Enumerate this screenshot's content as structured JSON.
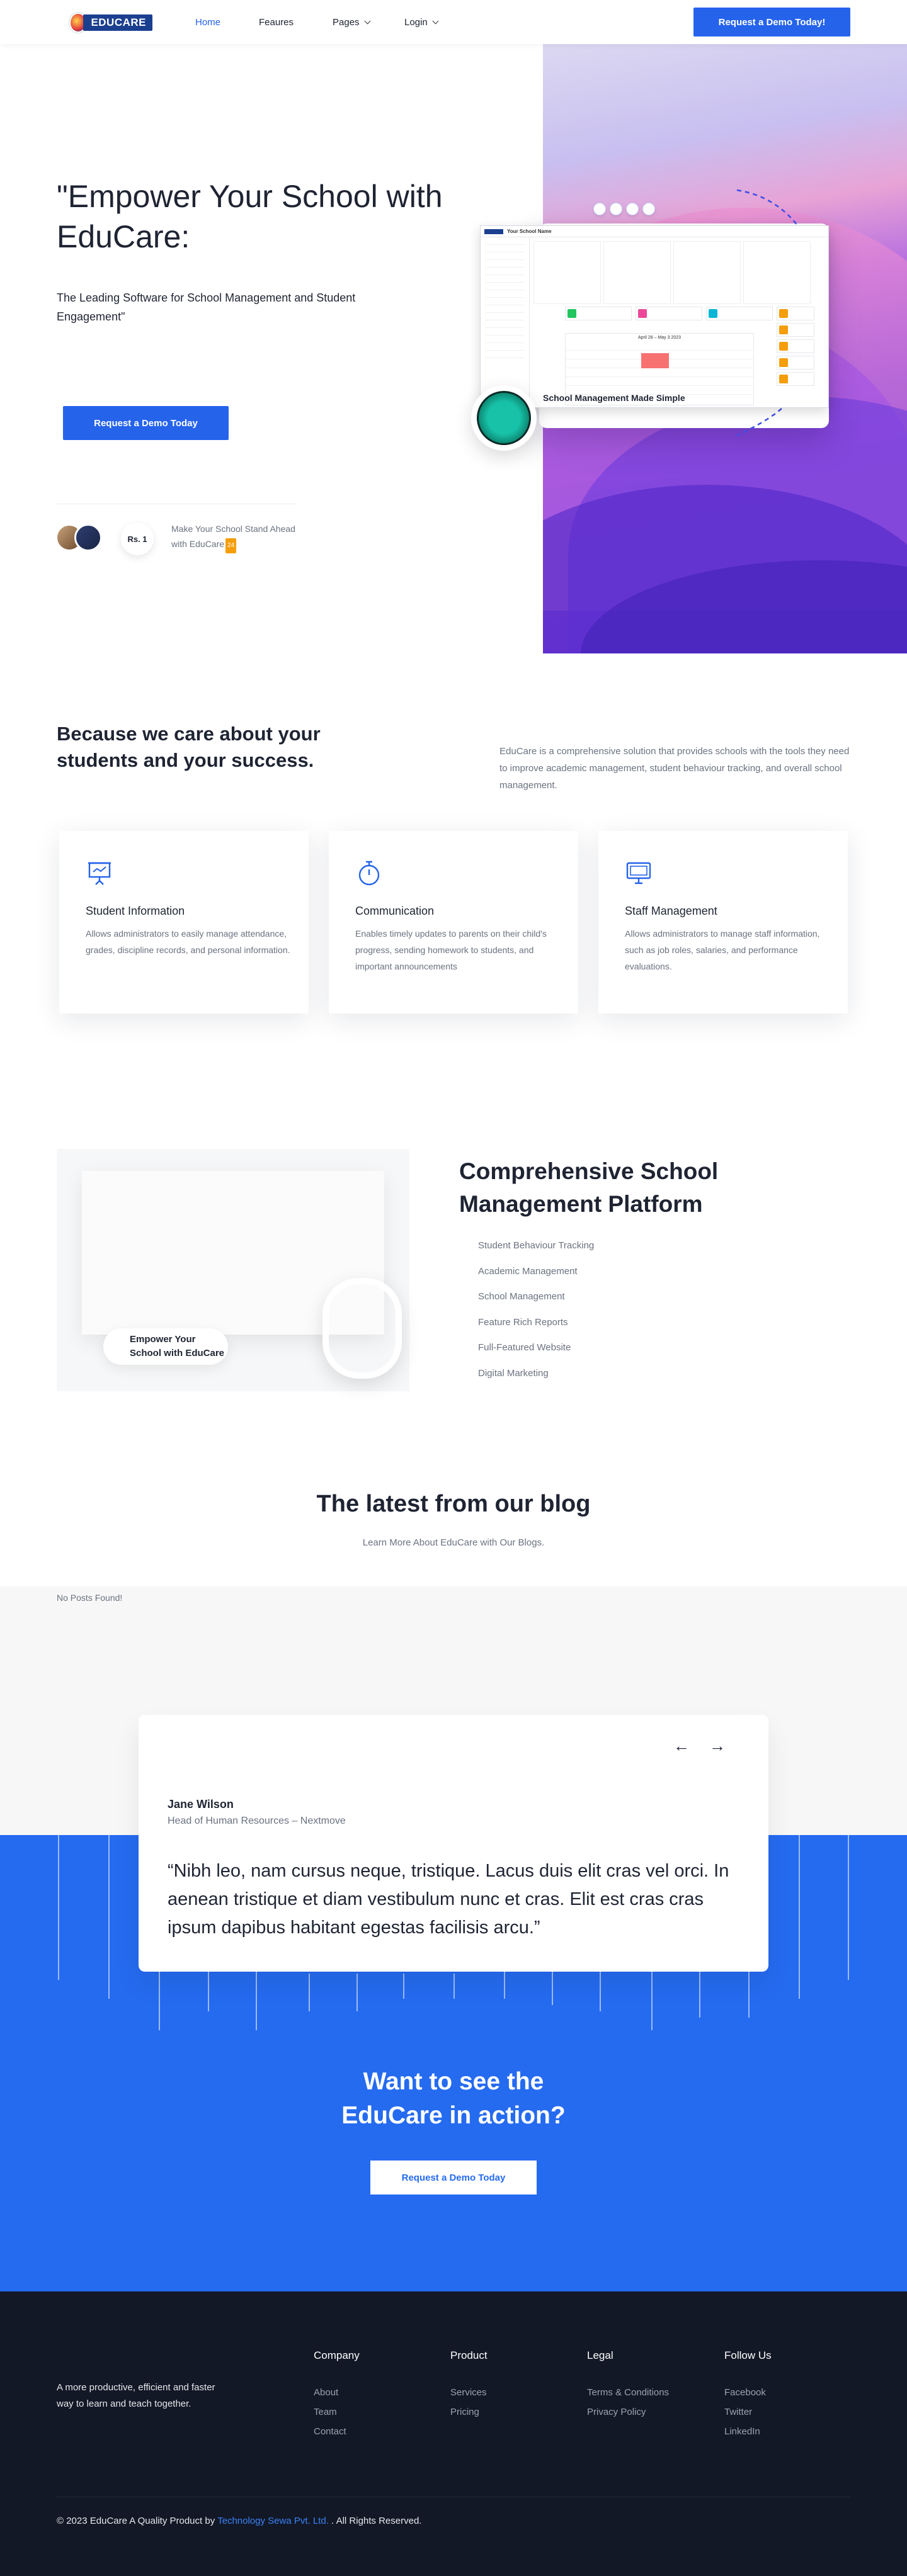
{
  "header": {
    "brand": "EDUCARE",
    "nav": [
      {
        "label": "Home",
        "active": true
      },
      {
        "label": "Feaures"
      },
      {
        "label": "Pages"
      },
      {
        "label": "Login"
      }
    ],
    "cta": "Request a Demo Today!"
  },
  "hero": {
    "title": "\"Empower Your School with EduCare:",
    "subtitle": "The Leading Software for School Management and Student Engagement\"",
    "cta": "Request a Demo Today",
    "badge": "Rs. 1",
    "stand_text": "Make Your School Stand Ahead with EduCare",
    "stand_tag": "24",
    "dashboard_caption": "School Management Made Simple",
    "dashboard_school": "Your School Name",
    "dashboard_week": "April 28 – May 3 2023"
  },
  "care": {
    "title": "Because we care about your students and your success.",
    "description": "EduCare is a comprehensive solution that provides schools with the tools they need to improve academic management, student behaviour tracking, and overall school management.",
    "features": [
      {
        "icon": "presentation-board-icon",
        "title": "Student Information",
        "text": "Allows administrators to easily manage attendance, grades, discipline records, and personal information."
      },
      {
        "icon": "stopwatch-icon",
        "title": "Communication",
        "text": "Enables timely updates to parents on their child's progress, sending homework  to students, and important announcements"
      },
      {
        "icon": "monitor-icon",
        "title": "Staff Management",
        "text": "Allows administrators to manage staff information, such as job roles, salaries, and performance evaluations."
      }
    ]
  },
  "platform": {
    "title": "Comprehensive School Management Platform",
    "image_pill": "Empower Your School with EduCare",
    "items": [
      "Student Behaviour Tracking",
      "Academic Management",
      "School Management",
      "Feature Rich Reports",
      "Full-Featured Website",
      "Digital Marketing"
    ]
  },
  "blog": {
    "title": "The latest from our blog",
    "subtitle": "Learn More About EduCare with Our Blogs.",
    "empty": "No Posts Found!"
  },
  "testimonial": {
    "name": "Jane Wilson",
    "role": "Head of Human Resources – Nextmove",
    "quote": "“Nibh leo, nam cursus neque, tristique. Lacus duis elit cras vel orci. In aenean tristique et diam vestibulum nunc et cras. Elit est cras cras ipsum dapibus habitant egestas facilisis arcu.”"
  },
  "cta": {
    "title": "Want to see the EduCare in action?",
    "button": "Request a Demo Today"
  },
  "footer": {
    "about": "A more productive, efficient and faster way to learn and teach together.",
    "columns": [
      {
        "title": "Company",
        "links": [
          "About",
          "Team",
          "Contact"
        ]
      },
      {
        "title": "Product",
        "links": [
          "Services",
          "Pricing"
        ]
      },
      {
        "title": "Legal",
        "links": [
          "Terms & Conditions",
          "Privacy Policy"
        ]
      },
      {
        "title": "Follow Us",
        "links": [
          "Facebook",
          "Twitter",
          "LinkedIn"
        ]
      }
    ],
    "copyright_pre": "© 2023 EduCare A Quality Product by ",
    "copyright_link": "Technology Sewa Pvt. Ltd.",
    "copyright_post": " . All Rights Reserved."
  },
  "colors": {
    "accent": "#2563eb",
    "cta_band": "#256bf0",
    "footer": "#121826"
  }
}
